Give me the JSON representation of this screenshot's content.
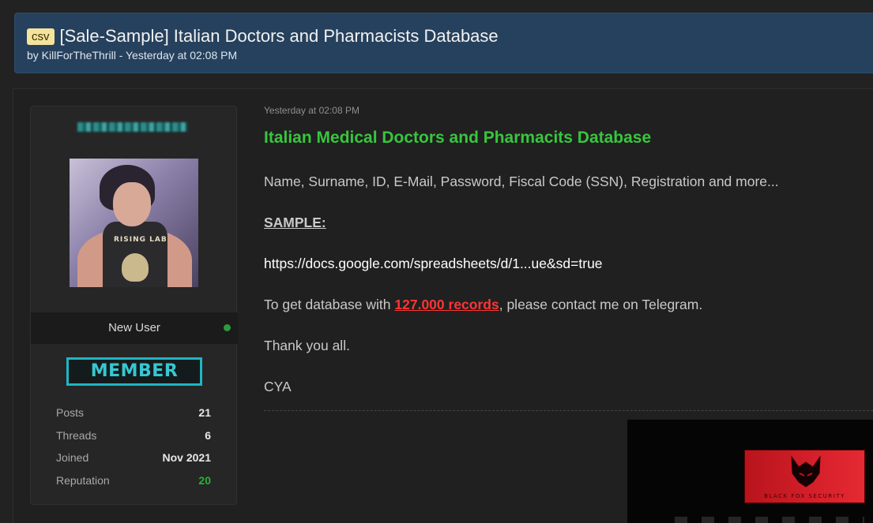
{
  "thread": {
    "prefix": "csv",
    "title": "[Sale-Sample] Italian Doctors and Pharmacists Database",
    "byline": "by KillForTheThrill - Yesterday at 02:08 PM"
  },
  "user_card": {
    "rank_title": "New User",
    "badge_label": "MEMBER",
    "avatar_shirt_text": "RISING LAB",
    "stats": [
      {
        "label": "Posts",
        "value": "21"
      },
      {
        "label": "Threads",
        "value": "6"
      },
      {
        "label": "Joined",
        "value": "Nov 2021"
      },
      {
        "label": "Reputation",
        "value": "20"
      }
    ],
    "colors": {
      "online": "#2f9a3b",
      "badge": "#1fb6c4",
      "reputation": "#24b336"
    }
  },
  "post": {
    "date": "Yesterday at 02:08 PM",
    "heading": "Italian Medical Doctors and Pharmacits Database",
    "fields_line": "Name, Surname, ID, E-Mail, Password, Fiscal Code (SSN), Registration and more...",
    "sample_label": "SAMPLE:",
    "sample_link": "https://docs.google.com/spreadsheets/d/1...ue&sd=true",
    "contact_prefix": "To get database with ",
    "records_link": "127.000 records",
    "contact_suffix": ", please contact me on Telegram.",
    "thanks": "Thank you all.",
    "signoff": "CYA",
    "colors": {
      "heading": "#38c63d",
      "records": "#ff3535"
    }
  },
  "signature_banner": {
    "logo_text": "BLACK FOX SECURITY",
    "logo_icon": "fox-icon"
  }
}
